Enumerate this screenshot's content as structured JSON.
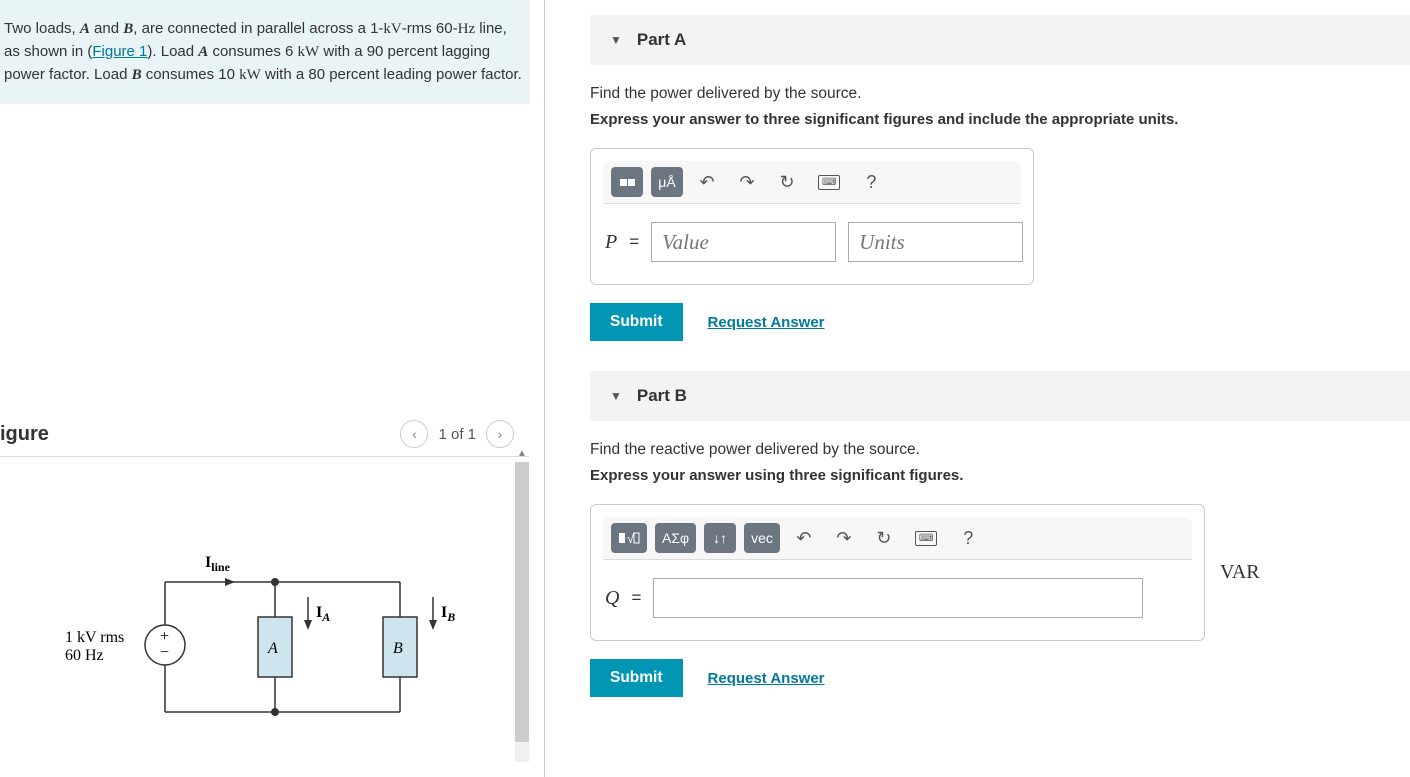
{
  "problem": {
    "text_parts": {
      "p1a": "Two loads, ",
      "A": "A",
      "p1b": " and ",
      "B": "B",
      "p1c": ", are connected in parallel across a 1-",
      "kV": "kV",
      "p1d": "-rms 60-",
      "Hz": "Hz",
      "p1e": " line, as shown in (",
      "figlink": "Figure 1",
      "p1f": "). Load ",
      "A2": "A",
      "p1g": " consumes 6 ",
      "kW": "kW",
      "p1h": " with a 90 percent lagging power factor. Load ",
      "B2": "B",
      "p1i": " consumes 10 ",
      "kW2": "kW",
      "p1j": " with a 80 percent leading power factor."
    }
  },
  "figure": {
    "title": "igure",
    "counter": "1 of 1",
    "labels": {
      "source1": "1 kV rms",
      "source2": "60 Hz",
      "iline": "I",
      "iline_sub": "line",
      "ia": "I",
      "ia_sub": "A",
      "ib": "I",
      "ib_sub": "B",
      "boxA": "A",
      "boxB": "B"
    }
  },
  "partA": {
    "title": "Part A",
    "prompt": "Find the power delivered by the source.",
    "instr": "Express your answer to three significant figures and include the appropriate units.",
    "toolbar": {
      "units_btn": "μÅ",
      "help": "?"
    },
    "var": "P",
    "eq": "=",
    "value_placeholder": "Value",
    "units_placeholder": "Units",
    "submit": "Submit",
    "request": "Request Answer"
  },
  "partB": {
    "title": "Part B",
    "prompt": "Find the reactive power delivered by the source.",
    "instr": "Express your answer using three significant figures.",
    "toolbar": {
      "greek": "ΑΣφ",
      "arrows": "↓↑",
      "vec": "vec",
      "help": "?"
    },
    "var": "Q",
    "eq": "=",
    "unit": "VAR",
    "submit": "Submit",
    "request": "Request Answer"
  }
}
